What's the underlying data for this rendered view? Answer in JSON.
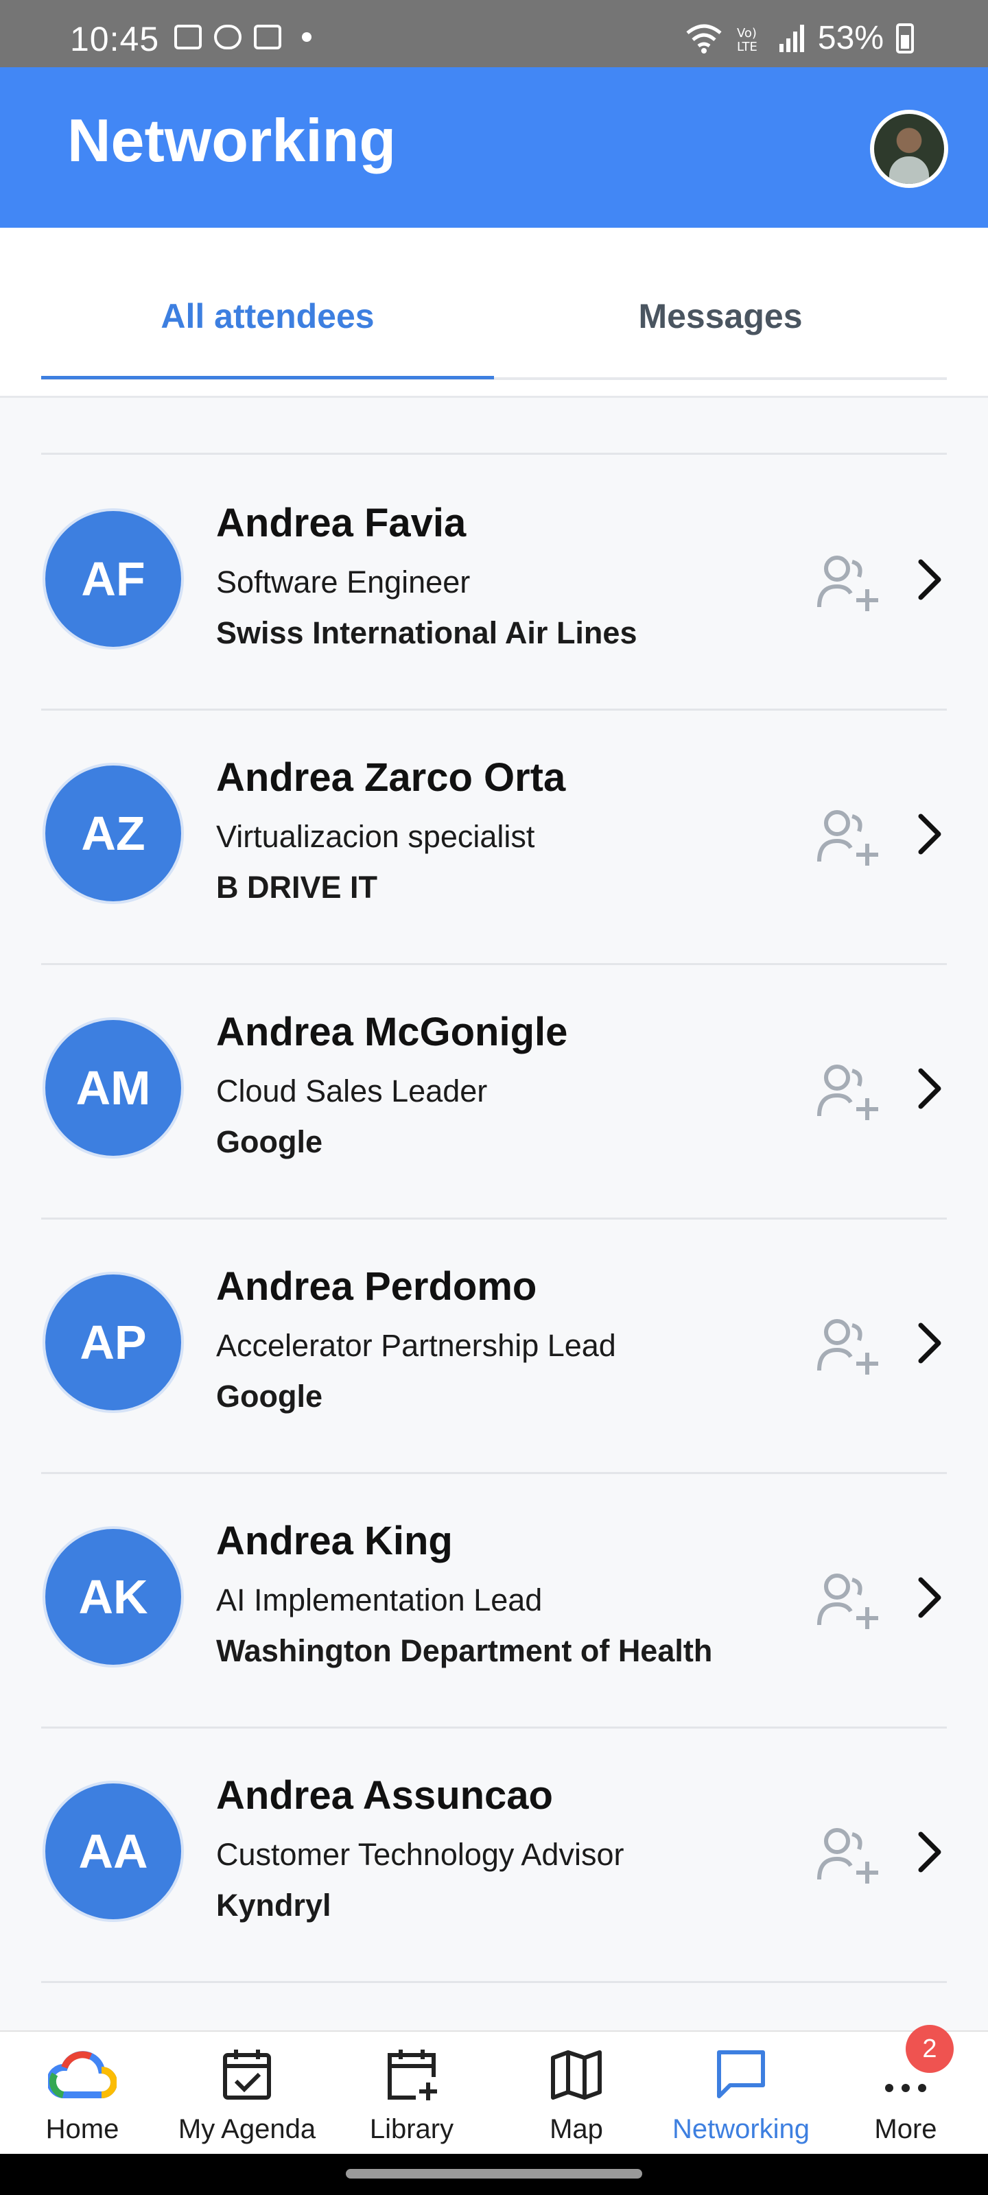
{
  "status_bar": {
    "time": "10:45",
    "battery": "53%"
  },
  "app_bar": {
    "title": "Networking"
  },
  "tabs": [
    {
      "label": "All attendees",
      "active": true
    },
    {
      "label": "Messages",
      "active": false
    }
  ],
  "attendees": [
    {
      "initials": "AF",
      "name": "Andrea Favia",
      "role": "Software Engineer",
      "company": "Swiss International  Air Lines"
    },
    {
      "initials": "AZ",
      "name": "Andrea Zarco Orta",
      "role": "Virtualizacion specialist",
      "company": "B DRIVE IT"
    },
    {
      "initials": "AM",
      "name": "Andrea McGonigle",
      "role": "Cloud Sales Leader",
      "company": "Google"
    },
    {
      "initials": "AP",
      "name": "Andrea Perdomo",
      "role": "Accelerator Partnership Lead",
      "company": "Google"
    },
    {
      "initials": "AK",
      "name": "Andrea King",
      "role": "AI Implementation Lead",
      "company": "Washington Department of Health"
    },
    {
      "initials": "AA",
      "name": "Andrea Assuncao",
      "role": "Customer Technology Advisor",
      "company": "Kyndryl"
    }
  ],
  "bottom_nav": [
    {
      "label": "Home",
      "icon": "google-cloud-icon"
    },
    {
      "label": "My Agenda",
      "icon": "calendar-check-icon"
    },
    {
      "label": "Library",
      "icon": "calendar-plus-icon"
    },
    {
      "label": "Map",
      "icon": "map-icon"
    },
    {
      "label": "Networking",
      "icon": "chat-icon",
      "active": true
    },
    {
      "label": "More",
      "icon": "more-icon",
      "badge": "2"
    }
  ],
  "colors": {
    "primary": "#4287f5",
    "accent": "#3d7fe0",
    "badge": "#ef5350"
  }
}
